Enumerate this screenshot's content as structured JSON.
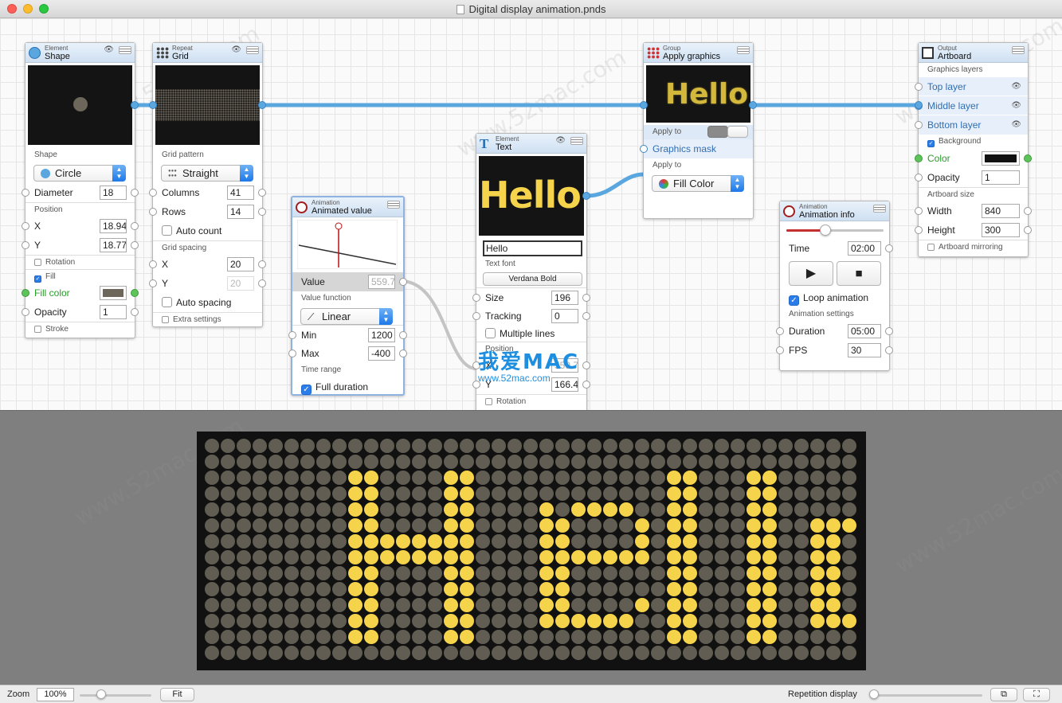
{
  "window": {
    "title": "Digital display animation.pnds"
  },
  "watermark": {
    "text": "www.52mac.com",
    "brand": "我爱MAC",
    "url": "www.52mac.com"
  },
  "nodes": {
    "shape": {
      "kind": "Element",
      "title": "Shape",
      "shape_label": "Shape",
      "shape_value": "Circle",
      "diameter_label": "Diameter",
      "diameter": "18",
      "position_label": "Position",
      "x_label": "X",
      "x": "18.94",
      "y_label": "Y",
      "y": "18.77",
      "rotation_label": "Rotation",
      "fill_label": "Fill",
      "fill_color_label": "Fill color",
      "fill_color": "#6d665a",
      "opacity_label": "Opacity",
      "opacity": "1",
      "stroke_label": "Stroke"
    },
    "grid": {
      "kind": "Repeat",
      "title": "Grid",
      "pattern_label": "Grid pattern",
      "pattern_value": "Straight",
      "columns_label": "Columns",
      "columns": "41",
      "rows_label": "Rows",
      "rows": "14",
      "auto_count_label": "Auto count",
      "spacing_label": "Grid spacing",
      "x_label": "X",
      "x": "20",
      "y_label": "Y",
      "y": "20",
      "auto_spacing_label": "Auto spacing",
      "extra_label": "Extra settings"
    },
    "anim_value": {
      "kind": "Animation",
      "title": "Animated value",
      "value_label": "Value",
      "value": "559.7",
      "function_label": "Value function",
      "function_value": "Linear",
      "min_label": "Min",
      "min": "1200",
      "max_label": "Max",
      "max": "-400",
      "time_range_label": "Time range",
      "full_duration_label": "Full duration"
    },
    "text": {
      "kind": "Element",
      "title": "Text",
      "preview": "Hello",
      "text_value": "Hello",
      "font_label": "Text font",
      "font_value": "Verdana Bold",
      "size_label": "Size",
      "size": "196",
      "tracking_label": "Tracking",
      "tracking": "0",
      "multiline_label": "Multiple lines",
      "position_label": "Position",
      "x_label": "X",
      "x": "559.7",
      "y_label": "Y",
      "y": "166.4",
      "rotation_label": "Rotation"
    },
    "apply": {
      "kind": "Group",
      "title": "Apply graphics",
      "preview": "Hello",
      "apply_to_label": "Apply to",
      "mask_label": "Graphics mask",
      "apply_to2_label": "Apply to",
      "fill_value": "Fill Color"
    },
    "anim_info": {
      "kind": "Animation",
      "title": "Animation info",
      "time_label": "Time",
      "time": "02:00",
      "progress": 0.4,
      "loop_label": "Loop animation",
      "settings_label": "Animation settings",
      "duration_label": "Duration",
      "duration": "05:00",
      "fps_label": "FPS",
      "fps": "30"
    },
    "artboard": {
      "kind": "Output",
      "title": "Artboard",
      "layers_label": "Graphics layers",
      "layers": [
        "Top layer",
        "Middle layer",
        "Bottom layer"
      ],
      "background_label": "Background",
      "color_label": "Color",
      "color": "#111111",
      "opacity_label": "Opacity",
      "opacity": "1",
      "size_label": "Artboard size",
      "width_label": "Width",
      "width": "840",
      "height_label": "Height",
      "height": "300",
      "mirroring_label": "Artboard mirroring"
    }
  },
  "display": {
    "dot_off": "#615d52",
    "dot_on": "#f5d44c",
    "background": "#111111",
    "columns": 41,
    "rows": 14,
    "shown_text": "Hello"
  },
  "statusbar": {
    "zoom_label": "Zoom",
    "zoom": "100%",
    "fit_label": "Fit",
    "repetition_label": "Repetition display"
  },
  "colors": {
    "accent": "#2b7de9",
    "wire": "#5aa7e0",
    "canvas": "#fafafa",
    "output_bg": "#7f7f7f"
  }
}
